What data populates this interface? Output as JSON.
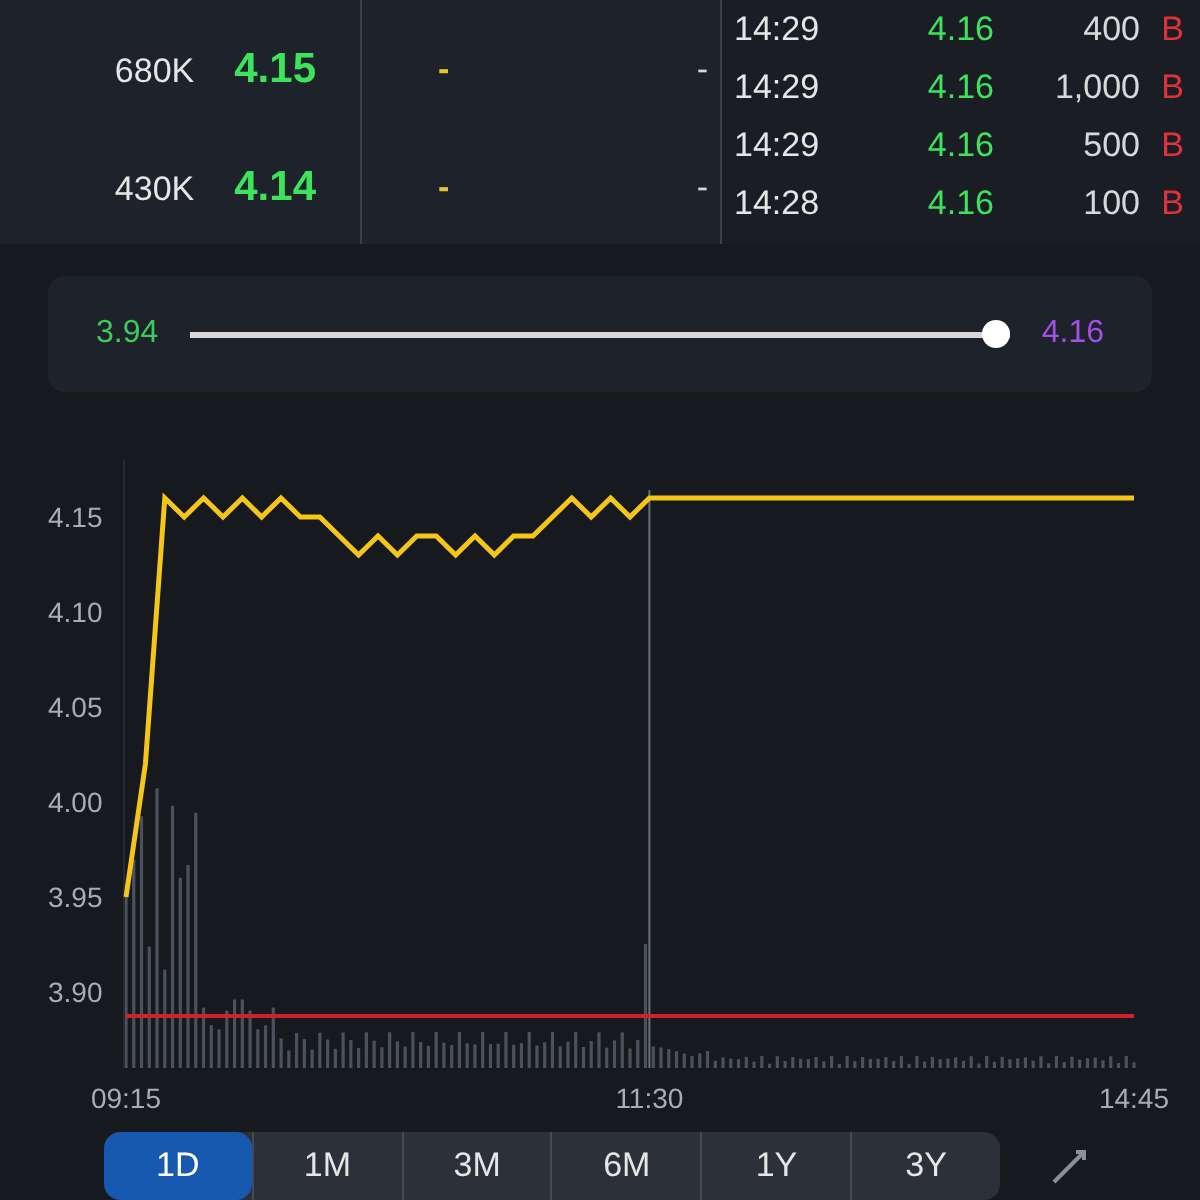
{
  "order_book": [
    {
      "volume": "680K",
      "price": "4.15",
      "column_3": "-",
      "column_4": "-"
    },
    {
      "volume": "430K",
      "price": "4.14",
      "column_3": "-",
      "column_4": "-"
    }
  ],
  "trades": [
    {
      "time": "14:29",
      "price": "4.16",
      "volume": "400",
      "side": "B"
    },
    {
      "time": "14:29",
      "price": "4.16",
      "volume": "1,000",
      "side": "B"
    },
    {
      "time": "14:29",
      "price": "4.16",
      "volume": "500",
      "side": "B"
    },
    {
      "time": "14:28",
      "price": "4.16",
      "volume": "100",
      "side": "B"
    }
  ],
  "range_slider": {
    "min_label": "3.94",
    "max_label": "4.16",
    "level": 1
  },
  "chart": {
    "chart_data": {
      "type": "line",
      "categories": [
        "09:15",
        null,
        null,
        null,
        null,
        null,
        null,
        null,
        null,
        null,
        null,
        null,
        null,
        null,
        null,
        null,
        null,
        null,
        null,
        null,
        null,
        null,
        null,
        null,
        null,
        null,
        null,
        "11:30",
        null,
        null,
        null,
        null,
        null,
        null,
        null,
        null,
        null,
        null,
        null,
        null,
        null,
        null,
        null,
        null,
        null,
        null,
        null,
        null,
        null,
        null,
        null,
        null,
        "14:45"
      ],
      "series": [
        {
          "color": "#f5c518",
          "values": [
            3.95,
            4.02,
            4.16,
            4.15,
            4.16,
            4.15,
            4.16,
            4.15,
            4.16,
            4.15,
            4.15,
            4.14,
            4.13,
            4.14,
            4.13,
            4.14,
            4.14,
            4.13,
            4.14,
            4.13,
            4.14,
            4.14,
            4.15,
            4.16,
            4.15,
            4.16,
            4.15,
            4.16,
            4.16,
            4.16,
            4.16,
            4.16,
            4.16,
            4.16,
            4.16,
            4.16,
            4.16,
            4.16,
            4.16,
            4.16,
            4.16,
            4.16,
            4.16,
            4.16,
            4.16,
            4.16,
            4.16,
            4.16,
            4.16,
            4.16,
            4.16,
            4.16,
            4.16
          ]
        }
      ],
      "ylim": [
        3.86,
        4.18
      ],
      "yticks": [
        {
          "value": 3.9,
          "label": "3.90"
        },
        {
          "value": 3.95,
          "label": "3.95"
        },
        {
          "value": 4.0,
          "label": "4.00"
        },
        {
          "value": 4.05,
          "label": "4.05"
        },
        {
          "value": 4.1,
          "label": "4.10"
        },
        {
          "value": 4.15,
          "label": "4.15"
        }
      ]
    }
  },
  "period_tabs": [
    {
      "label": "1D",
      "selected": true
    },
    {
      "label": "1M",
      "selected": false
    },
    {
      "label": "3M",
      "selected": false
    },
    {
      "label": "6M",
      "selected": false
    },
    {
      "label": "1Y",
      "selected": false
    },
    {
      "label": "3Y",
      "selected": false
    }
  ]
}
